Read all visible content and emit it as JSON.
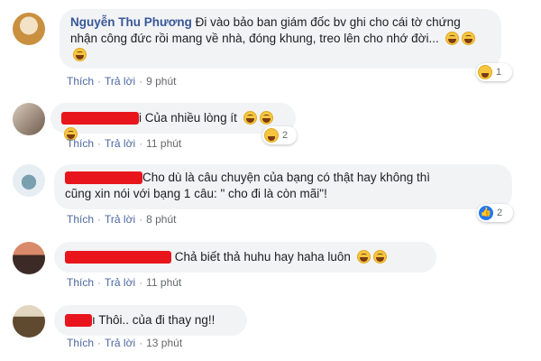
{
  "comments": [
    {
      "author": "Nguyễn Thu Phương",
      "text": "Đi vào bảo ban giám đốc bv ghi cho cái tờ chứng nhận công đức rồi mang về nhà, đóng khung, treo lên cho nhớ đời... ",
      "emojis": "😁😁😁",
      "actions": {
        "like": "Thích",
        "reply": "Trả lời",
        "time": "9 phút"
      },
      "reaction": {
        "icon": "haha-icon",
        "count": "1"
      },
      "avatar_colors": [
        "#f3e2c5",
        "#c9903f"
      ]
    },
    {
      "author_redacted": true,
      "text": "i Của nhiều lòng ít ",
      "actions": {
        "like": "Thích",
        "reply": "Trả lời",
        "time": "11 phút"
      },
      "reaction": {
        "icon": "haha-icon",
        "count": "2"
      },
      "avatar_colors": [
        "#cbb9a6",
        "#6d5a4a"
      ]
    },
    {
      "author_redacted": true,
      "text_line1": "Cho dù là câu chuyện của bạng có thật hay không thì",
      "text_line2": "cũng xin nói với bạng 1 câu: \" cho đi là còn mãi\"!",
      "actions": {
        "like": "Thích",
        "reply": "Trả lời",
        "time": "8 phút"
      },
      "reaction": {
        "icon": "like-icon",
        "count": "2"
      },
      "avatar_colors": [
        "#e6eef3",
        "#7aa0b0"
      ]
    },
    {
      "author_redacted": true,
      "text": "Chả biết thả huhu hay haha luôn ",
      "actions": {
        "like": "Thích",
        "reply": "Trả lời",
        "time": "11 phút"
      },
      "avatar_colors": [
        "#b86a4d",
        "#3c2a26"
      ]
    },
    {
      "author_redacted": true,
      "text": "ı Thôi.. của đi thay ng!!",
      "actions": {
        "like": "Thích",
        "reply": "Trả lời",
        "time": "13 phút"
      },
      "avatar_colors": [
        "#c7b08a",
        "#5f4a2f"
      ]
    }
  ]
}
